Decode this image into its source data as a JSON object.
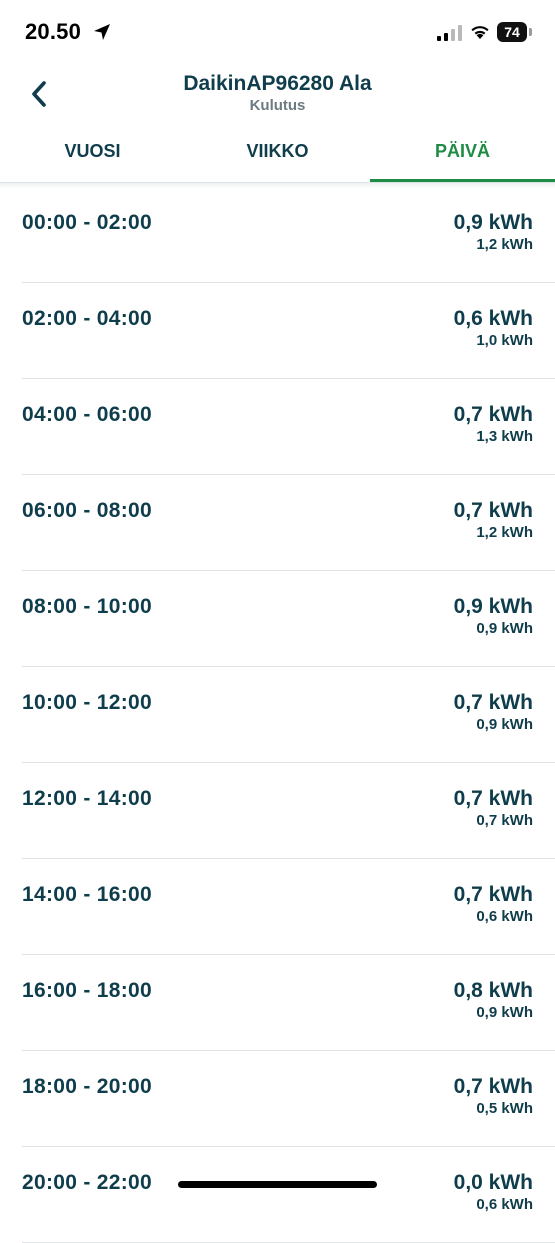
{
  "status_bar": {
    "time": "20.50",
    "battery_level": "74"
  },
  "header": {
    "title": "DaikinAP96280 Ala",
    "subtitle": "Kulutus"
  },
  "tabs": [
    {
      "label": "VUOSI",
      "active": false
    },
    {
      "label": "VIIKKO",
      "active": false
    },
    {
      "label": "PÄIVÄ",
      "active": true
    }
  ],
  "rows": [
    {
      "time": "00:00 - 02:00",
      "value": "0,9 kWh",
      "compare": "1,2 kWh"
    },
    {
      "time": "02:00 - 04:00",
      "value": "0,6 kWh",
      "compare": "1,0 kWh"
    },
    {
      "time": "04:00 - 06:00",
      "value": "0,7 kWh",
      "compare": "1,3 kWh"
    },
    {
      "time": "06:00 - 08:00",
      "value": "0,7 kWh",
      "compare": "1,2 kWh"
    },
    {
      "time": "08:00 - 10:00",
      "value": "0,9 kWh",
      "compare": "0,9 kWh"
    },
    {
      "time": "10:00 - 12:00",
      "value": "0,7 kWh",
      "compare": "0,9 kWh"
    },
    {
      "time": "12:00 - 14:00",
      "value": "0,7 kWh",
      "compare": "0,7 kWh"
    },
    {
      "time": "14:00 - 16:00",
      "value": "0,7 kWh",
      "compare": "0,6 kWh"
    },
    {
      "time": "16:00 - 18:00",
      "value": "0,8 kWh",
      "compare": "0,9 kWh"
    },
    {
      "time": "18:00 - 20:00",
      "value": "0,7 kWh",
      "compare": "0,5 kWh"
    },
    {
      "time": "20:00 - 22:00",
      "value": "0,0 kWh",
      "compare": "0,6 kWh"
    }
  ],
  "colors": {
    "text": "#0f3d4c",
    "accent": "#1e8c45",
    "divider": "#dfe4e6"
  }
}
